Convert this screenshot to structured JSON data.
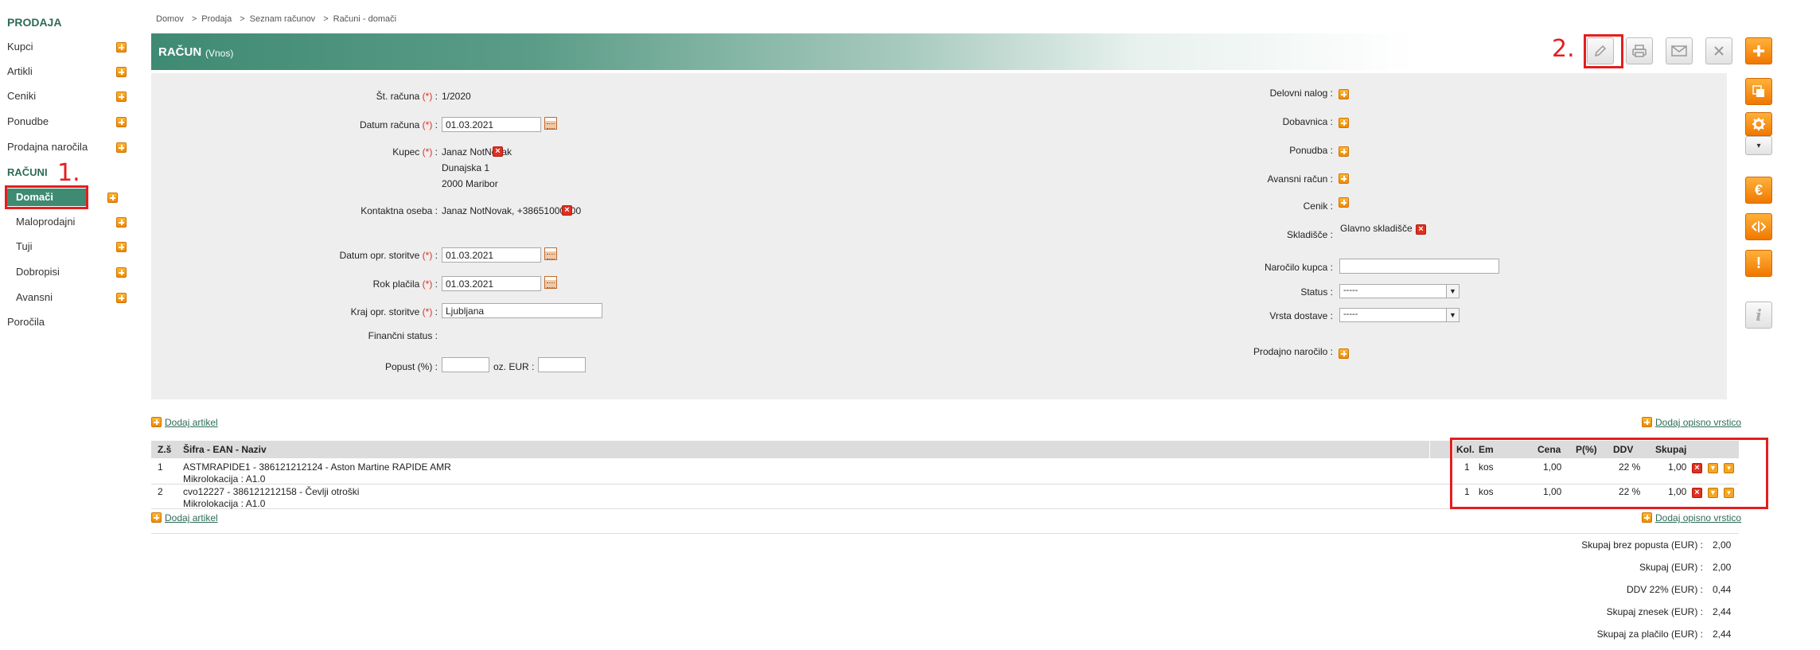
{
  "sidebar": {
    "section1": "PRODAJA",
    "items1": [
      {
        "label": "Kupci"
      },
      {
        "label": "Artikli"
      },
      {
        "label": "Ceniki"
      },
      {
        "label": "Ponudbe"
      },
      {
        "label": "Prodajna naročila"
      }
    ],
    "section2": "RAČUNI",
    "sub_items": [
      {
        "label": "Domači"
      },
      {
        "label": "Maloprodajni"
      },
      {
        "label": "Tuji"
      },
      {
        "label": "Dobropisi"
      },
      {
        "label": "Avansni"
      }
    ],
    "reports": "Poročila"
  },
  "annotations": {
    "a1": "1.",
    "a2": "2."
  },
  "breadcrumb": [
    "Domov",
    "Prodaja",
    "Seznam računov",
    "Računi - domači"
  ],
  "breadcrumb_sep": ">",
  "title": {
    "main": "RAČUN",
    "sub": "(Vnos)"
  },
  "form": {
    "left": {
      "invoice_no_label": "Št. računa",
      "invoice_no": "1/2020",
      "date_label": "Datum računa",
      "date": "01.03.2021",
      "customer_label": "Kupec",
      "customer_name": "Janaz NotNovak",
      "customer_street": "Dunajska 1",
      "customer_city": "2000 Maribor",
      "contact_label": "Kontaktna oseba",
      "contact": "Janaz NotNovak, +38651000000",
      "service_date_label": "Datum opr. storitve",
      "service_date": "01.03.2021",
      "due_label": "Rok plačila",
      "due": "01.03.2021",
      "place_label": "Kraj opr. storitve",
      "place": "Ljubljana",
      "fin_status_label": "Finančni status :",
      "discount_label": "Popust (%) :",
      "discount_or_label": "oz. EUR :",
      "req_mark": "(*)",
      "colon": " :"
    },
    "right": {
      "work_order": "Delovni nalog :",
      "delivery_note": "Dobavnica :",
      "quote": "Ponudba :",
      "advance": "Avansni račun :",
      "pricelist": "Cenik :",
      "warehouse_label": "Skladišče :",
      "warehouse": "Glavno skladišče",
      "customer_order": "Naročilo kupca :",
      "status_label": "Status :",
      "status_value": "-----",
      "delivery_label": "Vrsta dostave :",
      "delivery_value": "-----",
      "sales_order": "Prodajno naročilo :"
    }
  },
  "links": {
    "add_item": "Dodaj artikel",
    "add_desc": "Dodaj opisno vrstico"
  },
  "table": {
    "headers": [
      "Z.š",
      "Šifra - EAN - Naziv",
      "Kol.",
      "Em",
      "Cena",
      "P(%)",
      "DDV",
      "Skupaj"
    ],
    "rows": [
      {
        "no": "1",
        "name": "ASTMRAPIDE1 - 386121212124 - Aston Martine RAPIDE AMR",
        "loc": "Mikrolokacija : A1.0",
        "qty": "1",
        "unit": "kos",
        "price": "1,00",
        "disc": "",
        "vat": "22 %",
        "total": "1,00"
      },
      {
        "no": "2",
        "name": "cvo12227 - 386121212158 - Čevlji otroški",
        "loc": "Mikrolokacija : A1.0",
        "qty": "1",
        "unit": "kos",
        "price": "1,00",
        "disc": "",
        "vat": "22 %",
        "total": "1,00"
      }
    ]
  },
  "totals": [
    {
      "label": "Skupaj brez popusta (EUR) :",
      "value": "2,00"
    },
    {
      "label": "Skupaj (EUR) :",
      "value": "2,00"
    },
    {
      "label": "DDV 22% (EUR) :",
      "value": "0,44"
    },
    {
      "label": "Skupaj znesek (EUR) :",
      "value": "2,44"
    },
    {
      "label": "Skupaj za plačilo (EUR) :",
      "value": "2,44"
    }
  ],
  "colors": {
    "brand": "#3f8a73",
    "accent": "#f08a00",
    "annotation": "#e41e1e"
  }
}
